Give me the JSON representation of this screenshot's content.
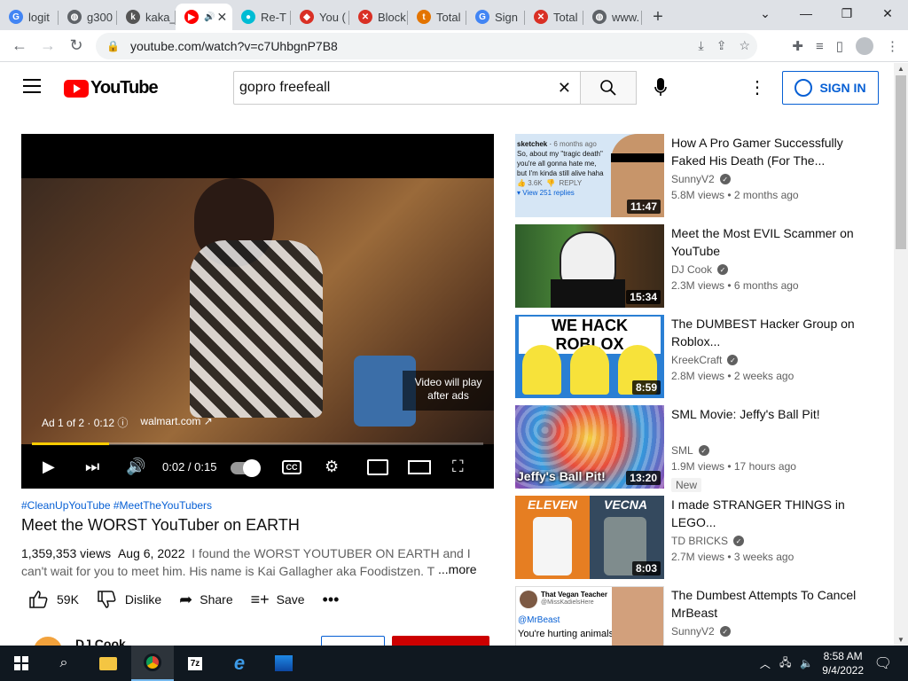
{
  "browser": {
    "tabs": [
      {
        "label": "logit",
        "favicon": "G",
        "color": "#4285f4"
      },
      {
        "label": "g300",
        "favicon": "globe",
        "color": "#5f6368"
      },
      {
        "label": "kaka_",
        "favicon": "k",
        "color": "#555555"
      },
      {
        "label": "",
        "favicon": "yt",
        "color": "#ff0000"
      },
      {
        "label": "Re-T",
        "favicon": "o",
        "color": "#00bcd4"
      },
      {
        "label": "You (",
        "favicon": "shield",
        "color": "#d93025"
      },
      {
        "label": "Block",
        "favicon": "x",
        "color": "#d93025"
      },
      {
        "label": "Total",
        "favicon": "t",
        "color": "#e37400"
      },
      {
        "label": "Sign",
        "favicon": "G",
        "color": "#4285f4"
      },
      {
        "label": "Total",
        "favicon": "x",
        "color": "#d93025"
      },
      {
        "label": "www.",
        "favicon": "globe",
        "color": "#5f6368"
      }
    ],
    "url": "youtube.com/watch?v=c7UhbgnP7B8"
  },
  "header": {
    "logo_text": "YouTube",
    "search_value": "gopro freefeall",
    "signin_label": "SIGN IN"
  },
  "player": {
    "ad_label": "Ad 1 of 2 · 0:12",
    "ad_site": "walmart.com",
    "will_play_line1": "Video will play",
    "will_play_line2": "after ads",
    "timecode": "0:02 / 0:15",
    "progress_fraction": 0.17
  },
  "video": {
    "hashtags": "#CleanUpYouTube #MeetTheYouTubers",
    "title": "Meet the WORST YouTuber on EARTH",
    "views": "1,359,353 views",
    "date": "Aug 6, 2022",
    "description": "I found the WORST YOUTUBER ON EARTH and I can't wait for you to meet him. His name is Kai Gallagher aka Foodistzen. This v",
    "more_label": "...more",
    "likes": "59K",
    "dislike_label": "Dislike",
    "share_label": "Share",
    "save_label": "Save",
    "channel": "DJ Cook"
  },
  "sidebar": {
    "items": [
      {
        "title": "How A Pro Gamer Successfully Faked His Death (For The...",
        "channel": "SunnyV2",
        "meta": "5.8M views • 2 months ago",
        "duration": "11:47",
        "new": false
      },
      {
        "title": "Meet the Most EVIL Scammer on YouTube",
        "channel": "DJ Cook",
        "meta": "2.3M views • 6 months ago",
        "duration": "15:34",
        "new": false
      },
      {
        "title": "The DUMBEST Hacker Group on Roblox...",
        "channel": "KreekCraft",
        "meta": "2.8M views • 2 weeks ago",
        "duration": "8:59",
        "new": false
      },
      {
        "title": "SML Movie: Jeffy's Ball Pit!",
        "channel": "SML",
        "meta": "1.9M views • 17 hours ago",
        "duration": "13:20",
        "new": true,
        "badge": "New"
      },
      {
        "title": "I made STRANGER THINGS in LEGO...",
        "channel": "TD BRICKS",
        "meta": "2.7M views • 3 weeks ago",
        "duration": "8:03",
        "new": false
      },
      {
        "title": "The Dumbest Attempts To Cancel MrBeast",
        "channel": "SunnyV2",
        "meta": "",
        "duration": "",
        "new": false
      }
    ],
    "thumb_texts": {
      "t1_user": "sketchek",
      "t1_ago": "6 months ago",
      "t1_line1": "So, about my \"tragic death\"",
      "t1_line2": "you're all gonna hate me,",
      "t1_line3": "but I'm kinda still alive haha",
      "t1_likes": "3.6K",
      "t1_reply": "REPLY",
      "t1_replies": "View 251 replies",
      "t3_banner": "WE HACK ROBLOX",
      "t4_banner": "Jeffy's Ball Pit!",
      "t5_left": "ELEVEN",
      "t5_right": "VECNA",
      "t6_user": "That Vegan Teacher",
      "t6_handle": "@MissKadielsHere",
      "t6_mention": "@MrBeast",
      "t6_line": "You're hurting animals"
    }
  },
  "taskbar": {
    "time": "8:58 AM",
    "date": "9/4/2022"
  }
}
